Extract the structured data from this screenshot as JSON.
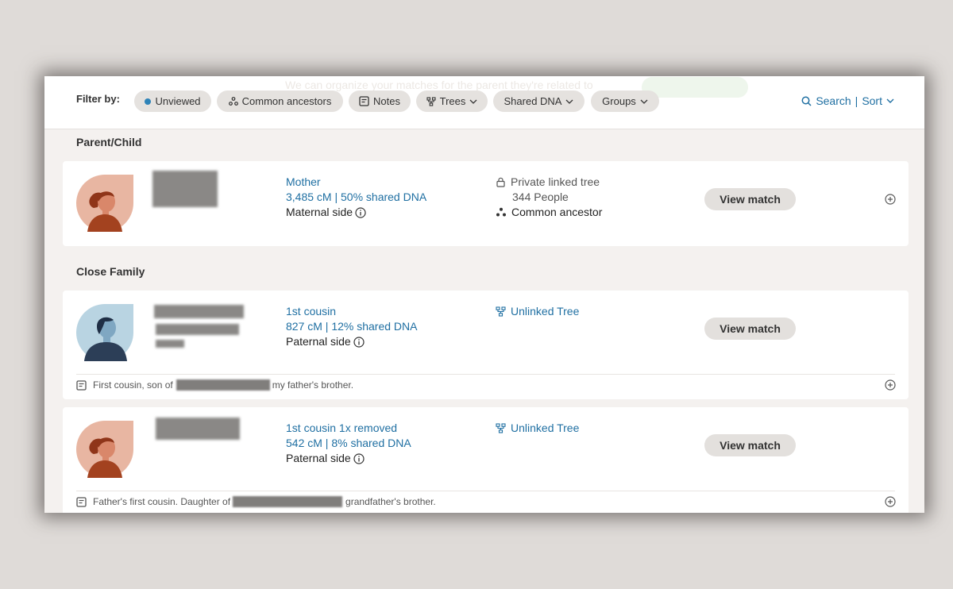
{
  "filter_bar": {
    "label": "Filter by:",
    "filters": [
      {
        "label": "Unviewed"
      },
      {
        "label": "Common ancestors"
      },
      {
        "label": "Notes"
      },
      {
        "label": "Trees"
      },
      {
        "label": "Shared DNA"
      },
      {
        "label": "Groups"
      }
    ],
    "search_label": "Search",
    "sort_label": "Sort",
    "separator": "|",
    "background_banner": "We can organize your matches for the parent they're related to"
  },
  "sections": [
    {
      "title": "Parent/Child",
      "matches": [
        {
          "avatar": "female-avatar",
          "relationship": "Mother",
          "shared_dna": "3,485 cM | 50% shared DNA",
          "side": "Maternal side",
          "tree_status": "Private linked tree",
          "tree_people": "344 People",
          "common_ancestor": "Common ancestor",
          "view_label": "View match"
        }
      ]
    },
    {
      "title": "Close Family",
      "matches": [
        {
          "avatar": "male-avatar",
          "relationship": "1st cousin",
          "shared_dna": "827 cM | 12% shared DNA",
          "side": "Paternal side",
          "tree_status": "Unlinked Tree",
          "view_label": "View match",
          "note_prefix": "First cousin, son of",
          "note_suffix": "my father's brother."
        },
        {
          "avatar": "female-avatar",
          "relationship": "1st cousin 1x removed",
          "shared_dna": "542 cM | 8% shared DNA",
          "side": "Paternal side",
          "tree_status": "Unlinked Tree",
          "view_label": "View match",
          "note_prefix": "Father's first cousin. Daughter of",
          "note_suffix": "grandfather's brother."
        }
      ]
    }
  ],
  "colors": {
    "link": "#1f6fa2",
    "unviewed_dot": "#2e83b8",
    "female_avatar_bg": "#e8b6a2",
    "female_avatar_body": "#a3421f",
    "male_avatar_bg": "#b9d4e2",
    "male_avatar_body": "#2c3e57"
  }
}
